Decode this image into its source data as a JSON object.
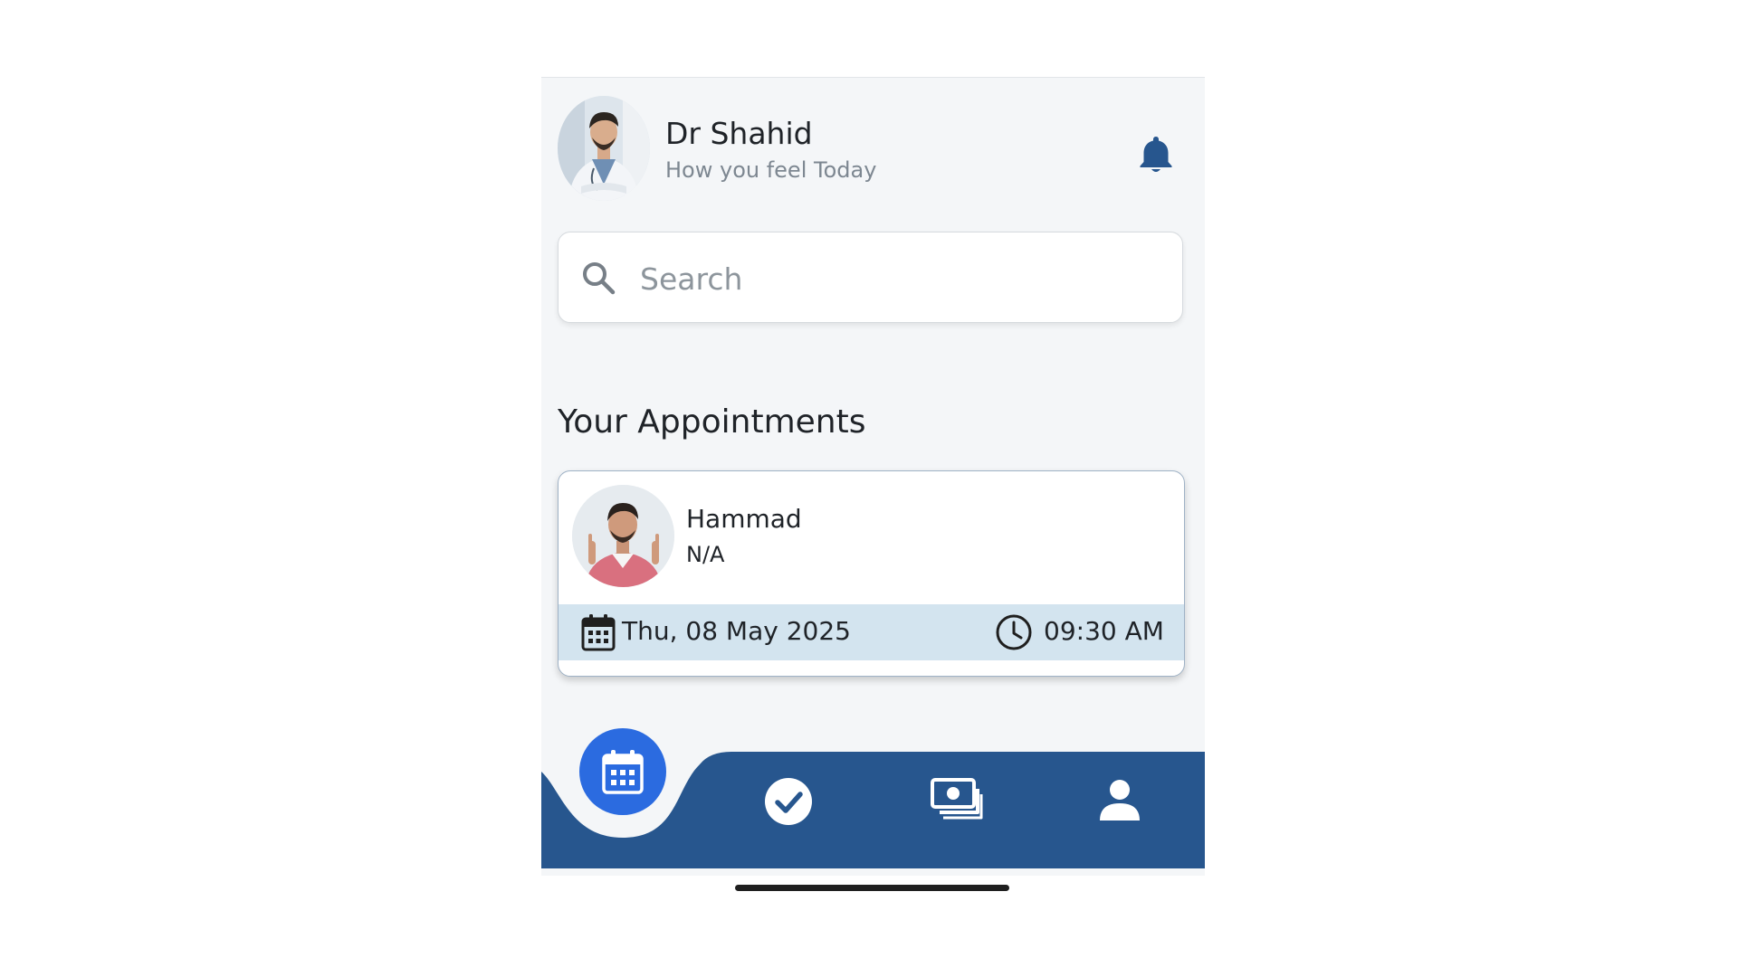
{
  "header": {
    "doctor_name": "Dr Shahid",
    "subtitle": "How you feel Today",
    "bell_icon": "notification-bell-icon"
  },
  "search": {
    "placeholder": "Search",
    "value": "",
    "icon": "search-icon"
  },
  "appointments": {
    "section_title": "Your Appointments",
    "items": [
      {
        "patient_name": "Hammad",
        "detail": "N/A",
        "date": "Thu, 08 May 2025",
        "time": "09:30 AM",
        "date_icon": "calendar-icon",
        "time_icon": "clock-icon"
      }
    ]
  },
  "bottom_nav": {
    "items": [
      {
        "id": "appointments",
        "icon": "calendar-icon",
        "active": true
      },
      {
        "id": "completed",
        "icon": "check-circle-icon",
        "active": false
      },
      {
        "id": "payments",
        "icon": "cash-icon",
        "active": false
      },
      {
        "id": "profile",
        "icon": "user-icon",
        "active": false
      }
    ]
  },
  "colors": {
    "primary_navy": "#27568e",
    "active_blue": "#2b6be0",
    "appt_footer_bg": "#d3e4ef",
    "page_bg": "#f4f6f8"
  }
}
